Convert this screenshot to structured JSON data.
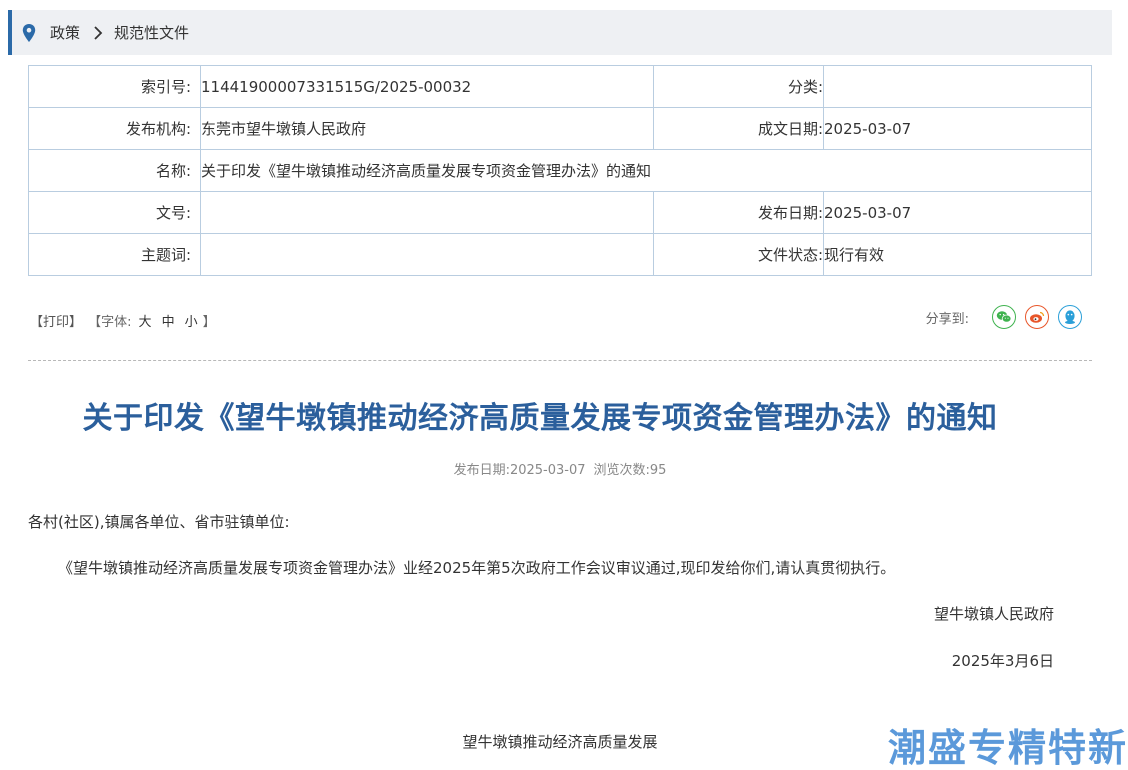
{
  "breadcrumb": {
    "home": "政策",
    "current": "规范性文件"
  },
  "meta": {
    "index_label": "索引号:",
    "index_value": "11441900007331515G/2025-00032",
    "category_label": "分类:",
    "category_value": "",
    "publisher_label": "发布机构:",
    "publisher_value": "东莞市望牛墩镇人民政府",
    "written_date_label": "成文日期:",
    "written_date_value": "2025-03-07",
    "name_label": "名称:",
    "name_value": "关于印发《望牛墩镇推动经济高质量发展专项资金管理办法》的通知",
    "doc_no_label": "文号:",
    "doc_no_value": "",
    "pub_date_label": "发布日期:",
    "pub_date_value": "2025-03-07",
    "keywords_label": "主题词:",
    "keywords_value": "",
    "status_label": "文件状态:",
    "status_value": "现行有效"
  },
  "tools": {
    "print": "【打印】",
    "font_open": "【字体:",
    "font_large": "大",
    "font_medium": "中",
    "font_small": "小",
    "font_close": "】",
    "share_label": "分享到:"
  },
  "share_icons": [
    "wechat-icon",
    "weibo-icon",
    "qq-icon"
  ],
  "article": {
    "title": "关于印发《望牛墩镇推动经济高质量发展专项资金管理办法》的通知",
    "pub_date": "发布日期:2025-03-07",
    "views": "浏览次数:95",
    "salutation": "各村(社区),镇属各单位、省市驻镇单位:",
    "body": "《望牛墩镇推动经济高质量发展专项资金管理办法》业经2025年第5次政府工作会议审议通过,现印发给你们,请认真贯彻执行。",
    "signature": "望牛墩镇人民政府",
    "date": "2025年3月6日",
    "attachment_heading": "望牛墩镇推动经济高质量发展"
  },
  "watermark": "潮盛专精特新",
  "colors": {
    "accent": "#2b6aa8",
    "title": "#2b5f9c",
    "border": "#b9cde0"
  }
}
